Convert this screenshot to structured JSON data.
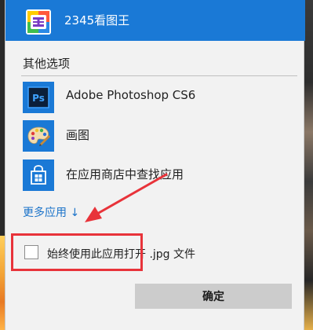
{
  "header": {
    "app_name": "2345看图王",
    "app_icon": "2345-viewer-icon"
  },
  "section": {
    "title": "其他选项"
  },
  "apps": [
    {
      "label": "Adobe Photoshop CS6",
      "icon": "photoshop-icon",
      "icon_text": "Ps"
    },
    {
      "label": "画图",
      "icon": "paint-palette-icon"
    },
    {
      "label": "在应用商店中查找应用",
      "icon": "store-bag-icon"
    }
  ],
  "more_apps": {
    "label": "更多应用 ↓"
  },
  "always_use": {
    "label": "始终使用此应用打开 .jpg 文件",
    "checked": false
  },
  "ok_button": {
    "label": "确定"
  },
  "colors": {
    "accent": "#1a79d6",
    "annotation_red": "#e8333a",
    "link": "#1b73c9"
  }
}
